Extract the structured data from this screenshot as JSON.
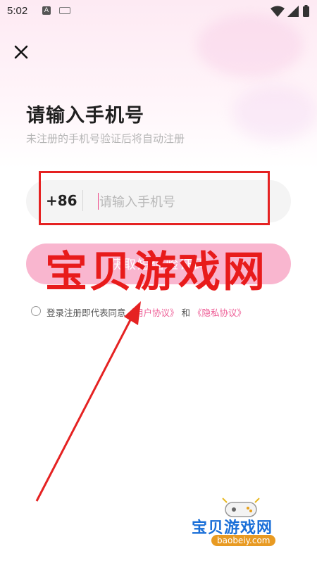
{
  "status_bar": {
    "time": "5:02",
    "input_badge": "A"
  },
  "header": {
    "title": "请输入手机号",
    "subtitle": "未注册的手机号验证后将自动注册"
  },
  "phone": {
    "country_code": "+86",
    "placeholder": "请输入手机号",
    "value": ""
  },
  "sms_button": {
    "label": "获取短信验证码"
  },
  "agreement": {
    "prefix": "登录注册即代表同意",
    "user_agreement": "《用户协议》",
    "conjunction": "和",
    "privacy_policy": "《隐私协议》"
  },
  "watermark": {
    "text": "宝贝游戏网"
  },
  "logo": {
    "name": "宝贝游戏网",
    "url": "baobeiy.com"
  },
  "colors": {
    "accent_pink": "#ee5c95",
    "button_pink": "#f9b6cf",
    "annotation_red": "#e52222"
  }
}
